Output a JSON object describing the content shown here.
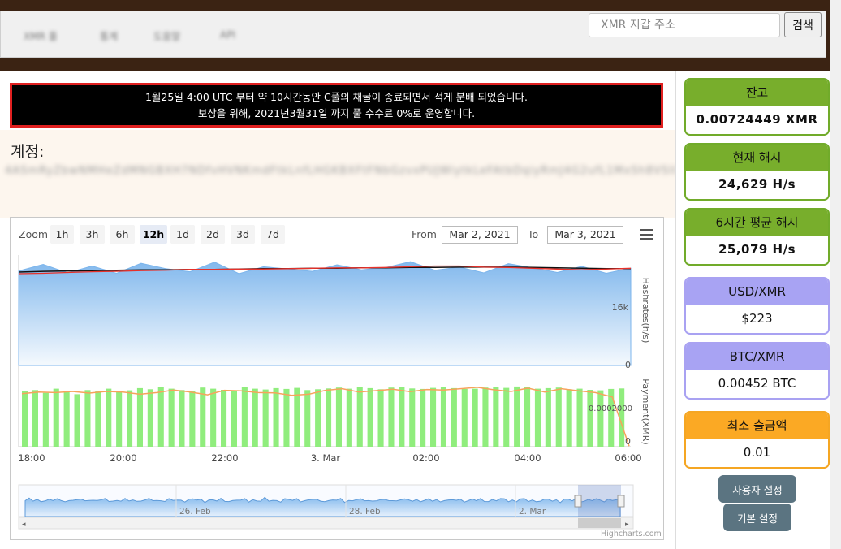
{
  "nav": {
    "items": [
      "XMR 풀",
      "통계",
      "도움말",
      "API"
    ],
    "search_placeholder": "XMR 지갑 주소",
    "search_button": "검색"
  },
  "notice": {
    "line1": "1월25일 4:00 UTC 부터 약 10시간동안 C풀의 채굴이 종료되면서 적게 분배 되었습니다.",
    "line2": "보상을 위해, 2021년3월31일 까지 풀 수수료 0%로 운영합니다."
  },
  "account": {
    "label": "계정:",
    "address": "4ASmRyZbwNMHeZdMNGBXH7NDfvHVNKmdFtkLnfLHGKBXFtFNbGzvxPUJWiytkLeFAtbDqiyRmJ4G2ufL1MxSh8VSlbwYa9nBmPZtbd2"
  },
  "chart_toolbar": {
    "zoom_label": "Zoom",
    "zoom_buttons": [
      "1h",
      "3h",
      "6h",
      "12h",
      "1d",
      "2d",
      "3d",
      "7d"
    ],
    "active_zoom": "12h",
    "from_label": "From",
    "from_value": "Mar 2, 2021",
    "to_label": "To",
    "to_value": "Mar 3, 2021",
    "credit": "Highcharts.com"
  },
  "chart_data": [
    {
      "type": "area",
      "ylabel": "Hashrates(h/s)",
      "yticks": [
        "16k",
        "0"
      ],
      "ylim": [
        0,
        28000
      ],
      "x": [
        "17:30",
        "18:00",
        "18:30",
        "19:00",
        "19:30",
        "20:00",
        "20:30",
        "21:00",
        "21:30",
        "22:00",
        "22:30",
        "23:00",
        "23:30",
        "00:00",
        "00:30",
        "01:00",
        "01:30",
        "02:00",
        "02:30",
        "03:00",
        "03:30",
        "04:00",
        "04:30",
        "05:00",
        "05:30",
        "06:00"
      ],
      "series": [
        {
          "values": [
            24500,
            26200,
            24000,
            25800,
            23900,
            26500,
            25100,
            24300,
            26800,
            23800,
            25600,
            25000,
            24400,
            26100,
            24800,
            25400,
            26900,
            24700,
            25500,
            24000,
            26400,
            25300,
            24100,
            25700,
            23900,
            25200
          ]
        },
        {
          "values": [
            24200,
            24400,
            24500,
            24600,
            24700,
            24800,
            24800,
            24900,
            24900,
            25000,
            25100,
            25100,
            25200,
            25200,
            25300,
            25300,
            25400,
            25400,
            25500,
            25500,
            25500,
            25400,
            25300,
            25200,
            25100,
            25100
          ]
        },
        {
          "values": [
            23800,
            23900,
            24100,
            24300,
            24400,
            24600,
            24700,
            24900,
            24900,
            25000,
            25000,
            25100,
            25200,
            25300,
            25300,
            25400,
            25600,
            25800,
            25800,
            25500,
            25400,
            25200,
            25000,
            24800,
            25000,
            25200
          ]
        }
      ]
    },
    {
      "type": "bar",
      "ylabel": "Payment(XMR)",
      "yticks": [
        "0.0002000",
        "0"
      ],
      "ylim": [
        0,
        0.00025
      ],
      "bar_count": 58,
      "values": [
        0.0002,
        0.000205,
        0.000195,
        0.00021,
        0.0002,
        0.00019,
        0.000205,
        0.0002,
        0.00021,
        0.000198,
        0.000204,
        0.000212,
        0.000208,
        0.000215,
        0.00021,
        0.000205,
        0.0002,
        0.000214,
        0.00021,
        0.000206,
        0.000203,
        0.000215,
        0.00021,
        0.000207,
        0.000212,
        0.000209,
        0.000213,
        0.000205,
        0.000208,
        0.000211,
        0.000214,
        0.00021,
        0.000215,
        0.000212,
        0.000208,
        0.000214,
        0.000216,
        0.000211,
        0.000209,
        0.000213,
        0.000215,
        0.000212,
        0.000209,
        0.00021,
        0.000214,
        0.000216,
        0.000213,
        0.000218,
        0.000215,
        0.00021,
        0.000212,
        0.000214,
        0.000208,
        0.00021,
        0.000206,
        0.000204,
        0.000209,
        0.000211
      ],
      "line_values": [
        0.000192,
        0.000198,
        0.000196,
        0.0002,
        0.000194,
        0.0002,
        0.000198,
        0.00019,
        0.000196,
        0.000205,
        0.000198,
        0.000188,
        0.000204,
        0.000202,
        0.000196,
        0.000195,
        0.000186,
        0.00019,
        0.000204,
        0.00021,
        0.000198,
        0.000203,
        0.000208,
        0.000199,
        0.000207,
        0.000205,
        0.00021,
        0.000215,
        0.000206,
        0.0002,
        0.000212,
        0.000198,
        0.00021,
        0.000202,
        0.000196,
        0.00018,
        2e-06
      ]
    }
  ],
  "x_axis_labels": [
    "18:00",
    "20:00",
    "22:00",
    "3. Mar",
    "02:00",
    "04:00",
    "06:00"
  ],
  "navigator_labels": [
    "26. Feb",
    "28. Feb",
    "2. Mar"
  ],
  "stats": [
    {
      "label": "잔고",
      "value": "0.00724449 XMR",
      "style": "green",
      "bold": true
    },
    {
      "label": "현재 해시",
      "value": "24,629 H/s",
      "style": "green",
      "bold": true
    },
    {
      "label": "6시간 평균 해시",
      "value": "25,079 H/s",
      "style": "green",
      "bold": true
    },
    {
      "label": "USD/XMR",
      "value": "$223",
      "style": "purple",
      "bold": false
    },
    {
      "label": "BTC/XMR",
      "value": "0.00452 BTC",
      "style": "purple",
      "bold": false
    },
    {
      "label": "최소 출금액",
      "value": "0.01",
      "style": "orange",
      "bold": false
    }
  ],
  "buttons": {
    "user_settings": "사용자 설정",
    "default_settings": "기본 설정"
  },
  "colors": {
    "header_brown": "#3b2313",
    "notice_border": "#e02020",
    "green": "#78ae2c",
    "purple": "#a8a3f3",
    "orange": "#fba924",
    "hashrate_area": "#7cb5ec",
    "payment_bar": "#90ed7d",
    "payment_line": "#f7a35c"
  }
}
